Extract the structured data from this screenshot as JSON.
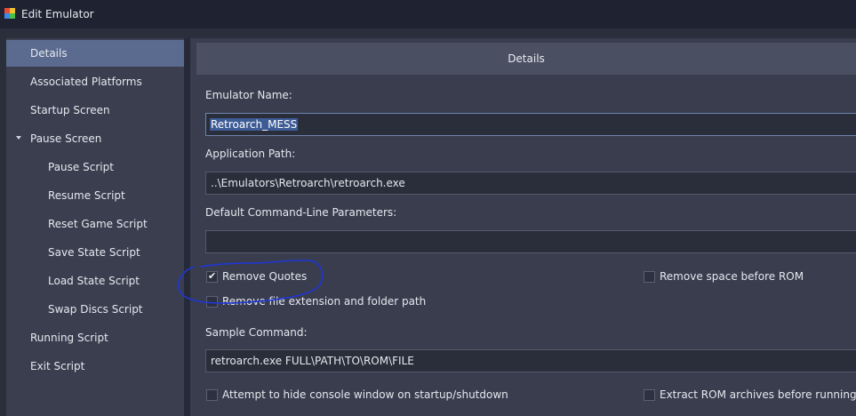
{
  "window": {
    "title": "Edit Emulator",
    "icon": "multicolor-cube-icon"
  },
  "sidebar": {
    "items": [
      {
        "label": "Details",
        "selected": true
      },
      {
        "label": "Associated Platforms"
      },
      {
        "label": "Startup Screen"
      },
      {
        "label": "Pause Screen",
        "expanded": true
      },
      {
        "label": "Pause Script"
      },
      {
        "label": "Resume Script"
      },
      {
        "label": "Reset Game Script"
      },
      {
        "label": "Save State Script"
      },
      {
        "label": "Load State Script"
      },
      {
        "label": "Swap Discs Script"
      },
      {
        "label": "Running Script"
      },
      {
        "label": "Exit Script"
      }
    ]
  },
  "panel": {
    "header": "Details",
    "emulator_name_label": "Emulator Name:",
    "emulator_name_value": "Retroarch_MESS",
    "app_path_label": "Application Path:",
    "app_path_value": "..\\Emulators\\Retroarch\\retroarch.exe",
    "cmdline_label": "Default Command-Line Parameters:",
    "cmdline_value": "",
    "remove_quotes": {
      "label": "Remove Quotes",
      "checked": true
    },
    "remove_space": {
      "label": "Remove space before ROM",
      "checked": false
    },
    "remove_ext": {
      "label": "Remove file extension and folder path",
      "checked": false
    },
    "sample_label": "Sample Command:",
    "sample_value": "retroarch.exe FULL\\PATH\\TO\\ROM\\FILE",
    "hide_console": {
      "label": "Attempt to hide console window on startup/shutdown",
      "checked": false
    },
    "extract_rom": {
      "label": "Extract ROM archives before running",
      "checked": false
    }
  },
  "colors": {
    "background": "#2b2e3b",
    "sidebar": "#3a3e4f",
    "selected": "#5a6b8f",
    "panel": "#393d4e",
    "annotation": "#1f36d8"
  }
}
